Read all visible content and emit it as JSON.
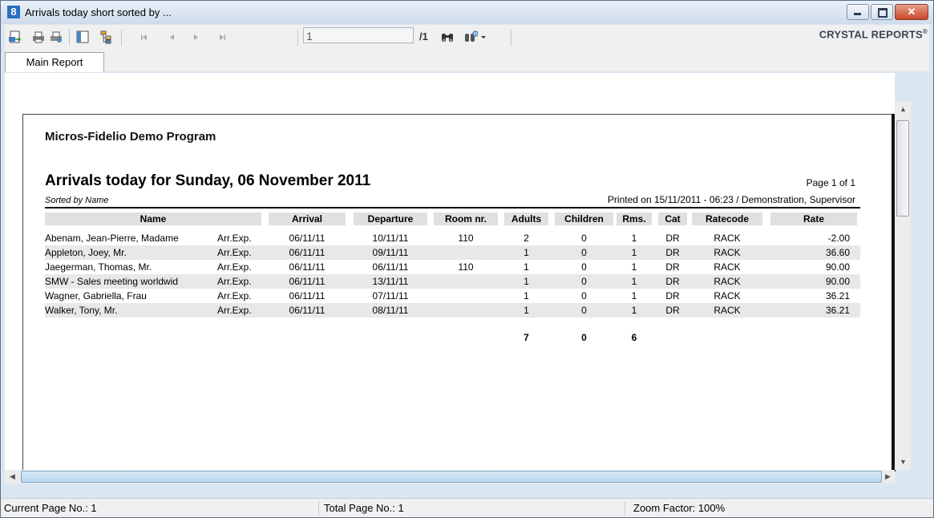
{
  "window": {
    "title": "Arrivals today short sorted by ...",
    "icon": "8"
  },
  "toolbar": {
    "page_value": "1",
    "page_total": "/1",
    "brand": "CRYSTAL REPORTS",
    "brand_mark": "®"
  },
  "tabs": [
    {
      "label": "Main Report"
    }
  ],
  "report": {
    "company": "Micros-Fidelio Demo Program",
    "title": "Arrivals today for Sunday, 06 November 2011",
    "page_info": "Page 1 of 1",
    "sorted_by": "Sorted by Name",
    "printed_on": "Printed on 15/11/2011 - 06:23 / Demonstration, Supervisor",
    "columns": [
      "Name",
      "Arrival",
      "Departure",
      "Room nr.",
      "Adults",
      "Children",
      "Rms.",
      "Cat",
      "Ratecode",
      "Rate"
    ],
    "rows": [
      {
        "name": "Abenam, Jean-Pierre, Madame",
        "status": "Arr.Exp.",
        "arrival": "06/11/11",
        "departure": "10/11/11",
        "room": "110",
        "adults": "2",
        "children": "0",
        "rms": "1",
        "cat": "DR",
        "ratecode": "RACK",
        "rate": "-2.00"
      },
      {
        "name": "Appleton, Joey, Mr.",
        "status": "Arr.Exp.",
        "arrival": "06/11/11",
        "departure": "09/11/11",
        "room": "",
        "adults": "1",
        "children": "0",
        "rms": "1",
        "cat": "DR",
        "ratecode": "RACK",
        "rate": "36.60"
      },
      {
        "name": "Jaegerman, Thomas, Mr.",
        "status": "Arr.Exp.",
        "arrival": "06/11/11",
        "departure": "06/11/11",
        "room": "110",
        "adults": "1",
        "children": "0",
        "rms": "1",
        "cat": "DR",
        "ratecode": "RACK",
        "rate": "90.00"
      },
      {
        "name": "SMW - Sales meeting worldwid",
        "status": "Arr.Exp.",
        "arrival": "06/11/11",
        "departure": "13/11/11",
        "room": "",
        "adults": "1",
        "children": "0",
        "rms": "1",
        "cat": "DR",
        "ratecode": "RACK",
        "rate": "90.00"
      },
      {
        "name": "Wagner, Gabriella, Frau",
        "status": "Arr.Exp.",
        "arrival": "06/11/11",
        "departure": "07/11/11",
        "room": "",
        "adults": "1",
        "children": "0",
        "rms": "1",
        "cat": "DR",
        "ratecode": "RACK",
        "rate": "36.21"
      },
      {
        "name": "Walker, Tony, Mr.",
        "status": "Arr.Exp.",
        "arrival": "06/11/11",
        "departure": "08/11/11",
        "room": "",
        "adults": "1",
        "children": "0",
        "rms": "1",
        "cat": "DR",
        "ratecode": "RACK",
        "rate": "36.21"
      }
    ],
    "totals": {
      "adults": "7",
      "children": "0",
      "rms": "6"
    }
  },
  "statusbar": {
    "current_page": "Current Page No.: 1",
    "total_page": "Total Page No.: 1",
    "zoom": "Zoom Factor: 100%"
  },
  "colors": {
    "accent": "#2a6fc0",
    "row_alt": "#e8e8e8",
    "header_bg": "#e0e0e0",
    "close_button": "#c9452a"
  }
}
